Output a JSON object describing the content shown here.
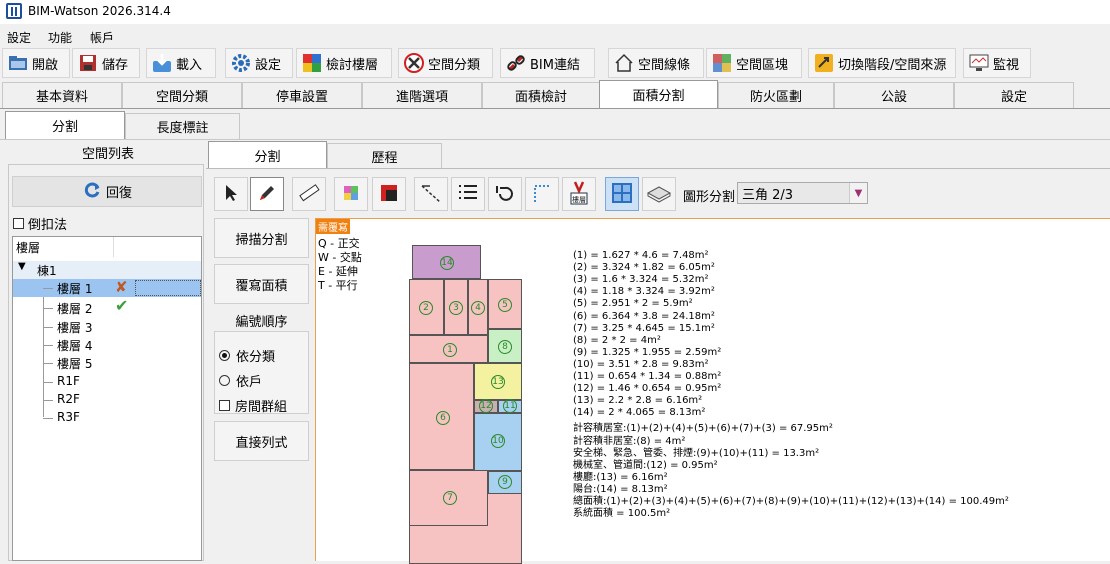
{
  "app": {
    "title": "BIM-Watson 2026.314.4"
  },
  "menu": [
    "設定",
    "功能",
    "帳戶"
  ],
  "toolbar": [
    {
      "label": "開啟",
      "icon": "open-folder-icon"
    },
    {
      "label": "儲存",
      "icon": "save-icon"
    },
    {
      "label": "載入",
      "icon": "download-icon"
    },
    {
      "label": "設定",
      "icon": "gear-icon"
    },
    {
      "label": "檢討樓層",
      "icon": "puzzle-icon"
    },
    {
      "label": "空間分類",
      "icon": "tools-icon"
    },
    {
      "label": "BIM連結",
      "icon": "link-icon"
    },
    {
      "label": "空間線條",
      "icon": "house-outline-icon"
    },
    {
      "label": "空間區塊",
      "icon": "color-blocks-icon"
    },
    {
      "label": "切換階段/空間來源",
      "icon": "switch-icon"
    },
    {
      "label": "監視",
      "icon": "monitor-icon"
    }
  ],
  "main_tabs": [
    "基本資料",
    "空間分類",
    "停車設置",
    "進階選項",
    "面積檢討",
    "面積分割",
    "防火區劃",
    "公設",
    "設定"
  ],
  "active_main_tab": "面積分割",
  "sub_tabs": [
    "分割",
    "長度標註"
  ],
  "left": {
    "title": "空間列表",
    "restore_label": "回復",
    "reverse_label": "倒扣法",
    "tree_header": "樓層",
    "building": "棟1",
    "floors": [
      "樓層 1",
      "樓層 2",
      "樓層 3",
      "樓層 4",
      "樓層 5",
      "R1F",
      "R2F",
      "R3F"
    ]
  },
  "inner_tabs": [
    "分割",
    "歷程"
  ],
  "side_buttons": {
    "scan": "掃描分割",
    "overwrite": "覆寫面積",
    "order_title": "編號順序",
    "by_class": "依分類",
    "by_unit": "依戶",
    "room_group": "房間群組",
    "direct_list": "直接列式"
  },
  "draw_mode": {
    "label": "圖形分割",
    "value": "三角 2/3"
  },
  "canvas": {
    "badge": "需覆寫",
    "shortcuts": [
      "Q - 正交",
      "W - 交點",
      "E - 延伸",
      "T - 平行"
    ],
    "rooms": [
      "14",
      "2",
      "3",
      "4",
      "5",
      "1",
      "8",
      "13",
      "6",
      "12",
      "11",
      "10",
      "9",
      "7"
    ],
    "calc": [
      "(1) = 1.627 * 4.6 = 7.48m²",
      "(2) = 3.324 * 1.82 = 6.05m²",
      "(3) = 1.6 * 3.324 = 5.32m²",
      "(4) = 1.18 * 3.324 = 3.92m²",
      "(5) = 2.951 * 2 = 5.9m²",
      "(6) = 6.364 * 3.8 = 24.18m²",
      "(7) = 3.25 * 4.645 = 15.1m²",
      "(8) = 2 * 2 = 4m²",
      "(9) = 1.325 * 1.955 = 2.59m²",
      "(10) = 3.51 * 2.8 = 9.83m²",
      "(11) = 0.654 * 1.34 = 0.88m²",
      "(12) = 1.46 * 0.654 = 0.95m²",
      "(13) = 2.2 * 2.8 = 6.16m²",
      "(14) = 2 * 4.065 = 8.13m²",
      "計容積居室:(1)+(2)+(4)+(5)+(6)+(7)+(3) = 67.95m²",
      "計容積非居室:(8) = 4m²",
      "安全梯、緊急、管委、排煙:(9)+(10)+(11) = 13.3m²",
      "機械室、管道間:(12) = 0.95m²",
      "樓廳:(13) = 6.16m²",
      "陽台:(14) = 8.13m²",
      "總面積:(1)+(2)+(3)+(4)+(5)+(6)+(7)+(8)+(9)+(10)+(11)+(12)+(13)+(14) = 100.49m²",
      "系統面積 = 100.5m²"
    ]
  }
}
